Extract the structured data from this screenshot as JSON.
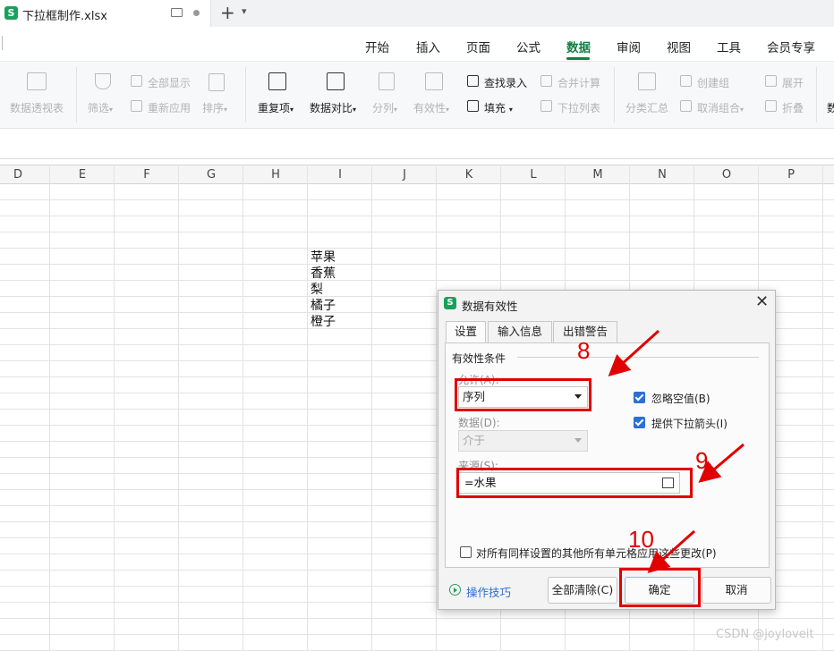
{
  "tabbar": {
    "app_logo": "S",
    "doc_title": "下拉框制作.xlsx"
  },
  "menu": {
    "items": [
      "开始",
      "插入",
      "页面",
      "公式",
      "数据",
      "审阅",
      "视图",
      "工具",
      "会员专享"
    ],
    "active": "数据"
  },
  "ribbon": {
    "pivot_table": "数据透视表",
    "filter": "筛选",
    "show_all": "全部显示",
    "reapply": "重新应用",
    "sort": "排序",
    "duplicates": "重复项",
    "compare": "数据对比",
    "split_column": "分列",
    "validity": "有效性",
    "find_entry": "查找录入",
    "fill": "填充",
    "consolidate": "合并计算",
    "dropdown_list": "下拉列表",
    "subtotal": "分类汇总",
    "create_group": "创建组",
    "ungroup": "取消组合",
    "expand": "展开",
    "collapse": "折叠",
    "cut_off": "数"
  },
  "grid": {
    "columns": [
      "D",
      "E",
      "F",
      "G",
      "H",
      "I",
      "J",
      "K",
      "L",
      "M",
      "N",
      "O",
      "P"
    ],
    "cells_col_I": [
      "苹果",
      "香蕉",
      "梨",
      "橘子",
      "橙子"
    ]
  },
  "dialog": {
    "logo": "S",
    "title": "数据有效性",
    "tabs": [
      "设置",
      "输入信息",
      "出错警告"
    ],
    "active_tab": "设置",
    "group_label": "有效性条件",
    "allow_label": "允许(A):",
    "allow_value": "序列",
    "data_label": "数据(D):",
    "data_value": "介于",
    "ignore_blank": {
      "label": "忽略空值(B)",
      "checked": true
    },
    "dropdown_arrow": {
      "label": "提供下拉箭头(I)",
      "checked": true
    },
    "source_label": "来源(S):",
    "source_value": "=水果",
    "apply_all": {
      "label": "对所有同样设置的其他所有单元格应用这些更改(P)",
      "checked": false
    },
    "tips_label": "操作技巧",
    "clear_all": "全部清除(C)",
    "ok": "确定",
    "cancel": "取消"
  },
  "annotations": {
    "step_8": "8",
    "step_9": "9",
    "step_10": "10",
    "arrow_color": "#e00000"
  },
  "watermark": "CSDN @joyloveit",
  "colors": {
    "accent": "#137e43",
    "checkbox": "#2c6fd6",
    "annotation": "#e00000"
  }
}
